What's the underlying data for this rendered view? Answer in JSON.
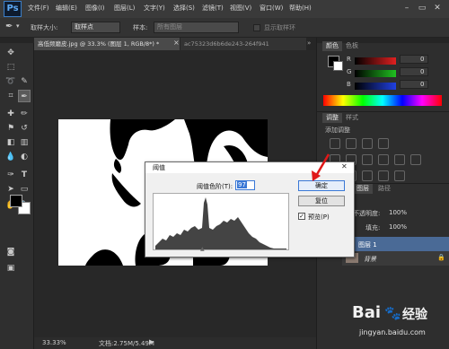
{
  "app": {
    "logo": "Ps"
  },
  "menubar": {
    "items": [
      "文件(F)",
      "编辑(E)",
      "图像(I)",
      "图层(L)",
      "文字(Y)",
      "选择(S)",
      "滤镜(T)",
      "视图(V)",
      "窗口(W)",
      "帮助(H)"
    ]
  },
  "window_controls": {
    "minimize": "–",
    "restore": "▭",
    "close": "✕"
  },
  "options": {
    "sample_size_label": "取样大小:",
    "sample_size_value": "取样点",
    "sample_label": "样本:",
    "sample_value": "所有图层",
    "show_ring_label": "显示取样环"
  },
  "tabs": [
    {
      "label": "高低频磨皮.jpg @ 33.3% (图层 1, RGB/8*) *",
      "close": "×",
      "active": true
    },
    {
      "label": "ac75323d6b6de243-264f941",
      "active": false
    }
  ],
  "status": {
    "zoom": "33.33%",
    "doc_info": "文档:2.75M/5.49M"
  },
  "right_panels": {
    "color_tabs": [
      "颜色",
      "色板"
    ],
    "channels": [
      {
        "label": "R",
        "value": "0",
        "color": "#e02020"
      },
      {
        "label": "G",
        "value": "0",
        "color": "#20c020"
      },
      {
        "label": "B",
        "value": "0",
        "color": "#2040e0"
      }
    ],
    "adjust_tabs": [
      "调整",
      "样式"
    ],
    "adjust_title": "添加调整",
    "layers_tabs": [
      "图层",
      "路径"
    ],
    "opacity_label": "不透明度:",
    "opacity_value": "100%",
    "fill_label": "填充:",
    "fill_value": "100%",
    "layers": [
      {
        "name": "图层 1",
        "selected": true
      },
      {
        "name": "背景",
        "selected": false
      }
    ]
  },
  "dialog": {
    "title": "阈值",
    "close": "✕",
    "threshold_label": "阈值色阶(T):",
    "threshold_value": "97",
    "ok_label": "确定",
    "reset_label": "复位",
    "preview_label": "预览(P)",
    "preview_checked": true
  },
  "watermark": {
    "brand": "Bai",
    "brand2": "经验",
    "url": "jingyan.baidu.com"
  },
  "colors": {
    "accent_arrow": "#e01818",
    "dialog_focus": "#3a78d6"
  },
  "icons": [
    "move-icon",
    "marquee-icon",
    "lasso-icon",
    "quick-select-icon",
    "crop-icon",
    "eyedropper-icon",
    "healing-icon",
    "brush-icon",
    "stamp-icon",
    "history-brush-icon",
    "eraser-icon",
    "gradient-icon",
    "blur-icon",
    "dodge-icon",
    "pen-icon",
    "type-icon",
    "path-select-icon",
    "shape-icon",
    "hand-icon",
    "zoom-icon"
  ]
}
